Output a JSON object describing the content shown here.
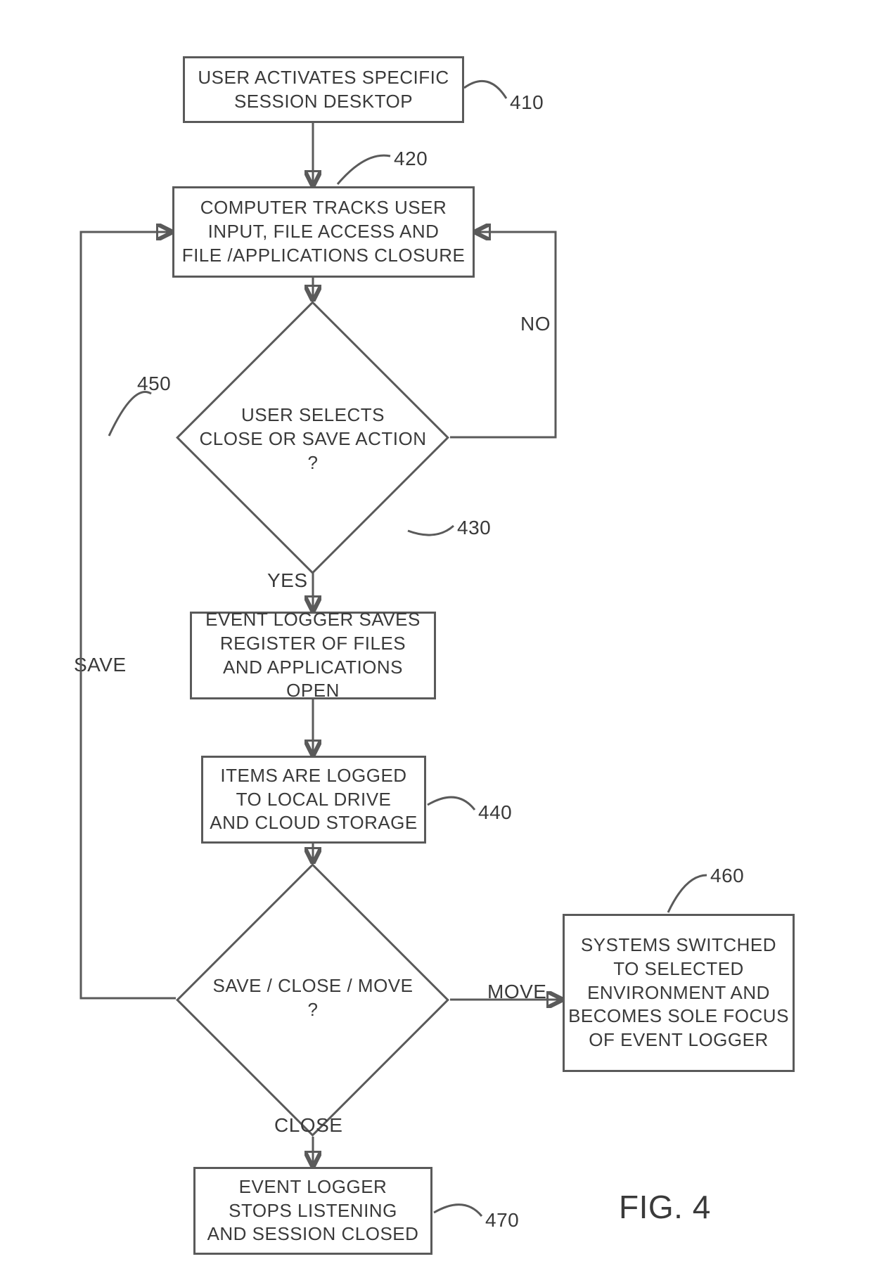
{
  "nodes": {
    "n410": {
      "text": "USER ACTIVATES SPECIFIC\nSESSION DESKTOP",
      "ref": "410"
    },
    "n420": {
      "text": "COMPUTER TRACKS USER\nINPUT, FILE ACCESS AND\nFILE /APPLICATIONS CLOSURE",
      "ref": "420"
    },
    "d430": {
      "text": "USER SELECTS\nCLOSE OR SAVE ACTION\n?",
      "ref": "430"
    },
    "n435": {
      "text": "EVENT LOGGER SAVES\nREGISTER OF FILES\nAND APPLICATIONS OPEN"
    },
    "n440": {
      "text": "ITEMS ARE LOGGED\nTO LOCAL DRIVE\nAND CLOUD STORAGE",
      "ref": "440"
    },
    "d450": {
      "text": "SAVE / CLOSE / MOVE\n?"
    },
    "n460": {
      "text": "SYSTEMS SWITCHED\nTO SELECTED\nENVIRONMENT AND\nBECOMES SOLE FOCUS\nOF EVENT LOGGER",
      "ref": "460"
    },
    "n470": {
      "text": "EVENT LOGGER\nSTOPS LISTENING\nAND SESSION CLOSED",
      "ref": "470"
    }
  },
  "edges": {
    "no": "NO",
    "yes": "YES",
    "save": "SAVE",
    "close": "CLOSE",
    "move": "MOVE"
  },
  "refs": {
    "r450": "450"
  },
  "figure": "FIG. 4"
}
